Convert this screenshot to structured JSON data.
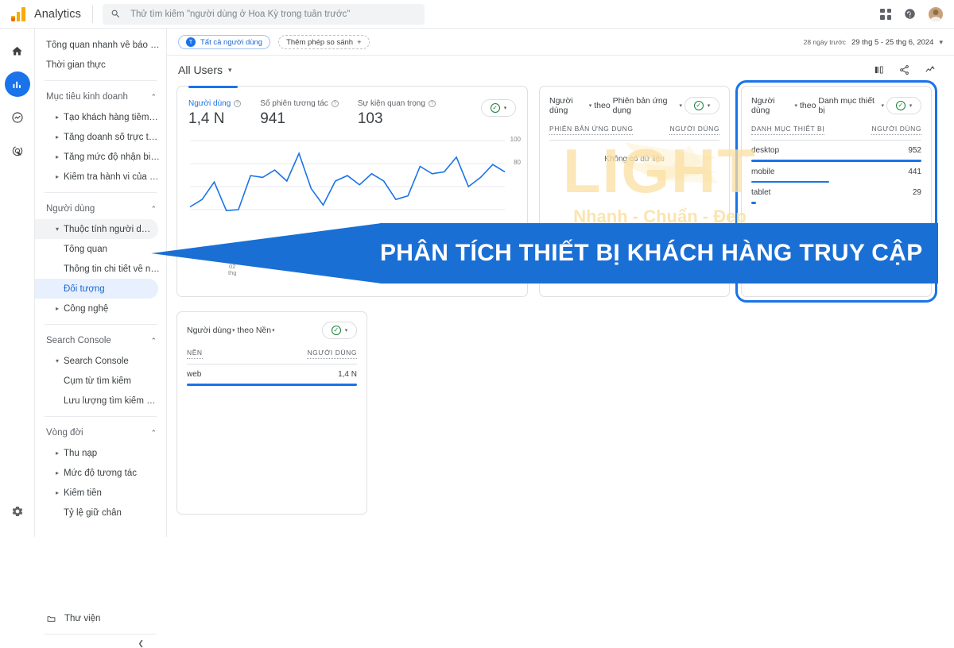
{
  "header": {
    "brand": "Analytics",
    "search_placeholder": "Thử tìm kiếm \"người dùng ở Hoa Kỳ trong tuần trước\"",
    "search_value": "",
    "apps_icon": "grid-apps-icon",
    "help_icon": "help-icon",
    "avatar_icon": "account-avatar"
  },
  "rail": {
    "items": [
      {
        "name": "home",
        "icon": "home-icon"
      },
      {
        "name": "reports",
        "icon": "reports-bar-chart-icon",
        "active": true
      },
      {
        "name": "explore",
        "icon": "explore-icon"
      },
      {
        "name": "advertising",
        "icon": "advertising-target-icon"
      }
    ],
    "settings_icon": "gear-icon"
  },
  "nav": {
    "items": [
      {
        "label": "Tổng quan nhanh về báo cáo",
        "type": "item"
      },
      {
        "label": "Thời gian thực",
        "type": "item"
      },
      {
        "type": "divider"
      },
      {
        "label": "Mục tiêu kinh doanh",
        "type": "group",
        "expanded": true
      },
      {
        "label": "Tạo khách hàng tiềm năng",
        "type": "sub",
        "arrow": "right"
      },
      {
        "label": "Tăng doanh số trực tuyến",
        "type": "sub",
        "arrow": "right"
      },
      {
        "label": "Tăng mức độ nhận biết thươn...",
        "type": "sub",
        "arrow": "right"
      },
      {
        "label": "Kiểm tra hành vi của người d...",
        "type": "sub",
        "arrow": "right"
      },
      {
        "type": "divider"
      },
      {
        "label": "Người dùng",
        "type": "group",
        "expanded": true
      },
      {
        "label": "Thuộc tính người dùng",
        "type": "sub",
        "arrow": "down",
        "soft": true
      },
      {
        "label": "Tổng quan",
        "type": "sub2"
      },
      {
        "label": "Thông tin chi tiết về nhân k...",
        "type": "sub2"
      },
      {
        "label": "Đối tượng",
        "type": "sub2",
        "selected": true
      },
      {
        "label": "Công nghệ",
        "type": "sub",
        "arrow": "right"
      },
      {
        "type": "divider"
      },
      {
        "label": "Search Console",
        "type": "group",
        "expanded": true
      },
      {
        "label": "Search Console",
        "type": "sub",
        "arrow": "down"
      },
      {
        "label": "Cụm từ tìm kiếm",
        "type": "sub2"
      },
      {
        "label": "Lưu lượng tìm kiếm không ...",
        "type": "sub2"
      },
      {
        "type": "divider"
      },
      {
        "label": "Vòng đời",
        "type": "group",
        "expanded": true
      },
      {
        "label": "Thu nạp",
        "type": "sub",
        "arrow": "right"
      },
      {
        "label": "Mức độ tương tác",
        "type": "sub",
        "arrow": "right"
      },
      {
        "label": "Kiếm tiền",
        "type": "sub",
        "arrow": "right"
      },
      {
        "label": "Tỷ lệ giữ chân",
        "type": "sub2"
      }
    ],
    "library_label": "Thư viện",
    "library_icon": "folder-icon",
    "collapse_icon": "chevron-left-icon"
  },
  "toolbar": {
    "segment_chip": "Tất cả người dùng",
    "segment_avatar": "T",
    "comparison_chip": "Thêm phép so sánh",
    "comparison_plus": "+",
    "date_ago": "28 ngày trước",
    "date_range": "29 thg 5 - 25 thg 6, 2024",
    "date_caret": "▾"
  },
  "subbar": {
    "audience": "All Users",
    "audience_caret": "▾",
    "icons": [
      "compare-icon",
      "share-icon",
      "insights-icon"
    ]
  },
  "overview_card": {
    "metrics": [
      {
        "label": "Người dùng",
        "value": "1,4 N",
        "active": true
      },
      {
        "label": "Số phiên tương tác",
        "value": "941",
        "active": false
      },
      {
        "label": "Sự kiện quan trọng",
        "value": "103",
        "active": false
      }
    ],
    "status_icon": "check-circle-icon",
    "status_caret": "▾"
  },
  "app_version_card": {
    "title_metric": "Người dùng",
    "title_by": "theo",
    "title_dimension": "Phiên bản ứng dụng",
    "col_dimension": "PHIÊN BẢN ỨNG DỤNG",
    "col_metric": "NGƯỜI DÙNG",
    "empty_text": "Không có dữ liệu",
    "status_icon": "check-circle-icon"
  },
  "device_card": {
    "title_metric": "Người dùng",
    "title_by": "theo",
    "title_dimension": "Danh mục thiết bị",
    "col_dimension": "DANH MỤC THIẾT BỊ",
    "col_metric": "NGƯỜI DÙNG",
    "status_icon": "check-circle-icon",
    "highlight_color": "#1a73e8",
    "rows": [
      {
        "label": "desktop",
        "value": "952"
      },
      {
        "label": "mobile",
        "value": "441"
      },
      {
        "label": "tablet",
        "value": "29"
      }
    ]
  },
  "platform_card": {
    "title_metric": "Người dùng",
    "title_by": "theo",
    "title_dimension": "Nền",
    "col_dimension": "NỀN",
    "col_metric": "NGƯỜI DÙNG",
    "status_icon": "check-circle-icon",
    "rows": [
      {
        "label": "web",
        "value": "1,4 N"
      }
    ]
  },
  "banner": {
    "text": "PHÂN TÍCH THIẾT BỊ KHÁCH HÀNG TRUY CẬP",
    "color": "#1a6fd4"
  },
  "watermark": {
    "title": "LIGHT",
    "subtitle": "Nhanh - Chuẩn - Đẹp",
    "color": "#fbe0a2"
  },
  "chart_data": {
    "type": "line",
    "title": "",
    "xlabel": "",
    "ylabel": "",
    "ylim": [
      0,
      100
    ],
    "yticks": [
      100,
      80
    ],
    "grid": true,
    "x_tick_labels": [
      "02 thg"
    ],
    "series": [
      {
        "name": "Người dùng",
        "color": "#1a73e8",
        "values": [
          28,
          36,
          55,
          24,
          25,
          62,
          60,
          68,
          56,
          86,
          48,
          30,
          56,
          62,
          52,
          64,
          56,
          36,
          40,
          72,
          64,
          66,
          82,
          50,
          60,
          74,
          66
        ]
      }
    ]
  }
}
